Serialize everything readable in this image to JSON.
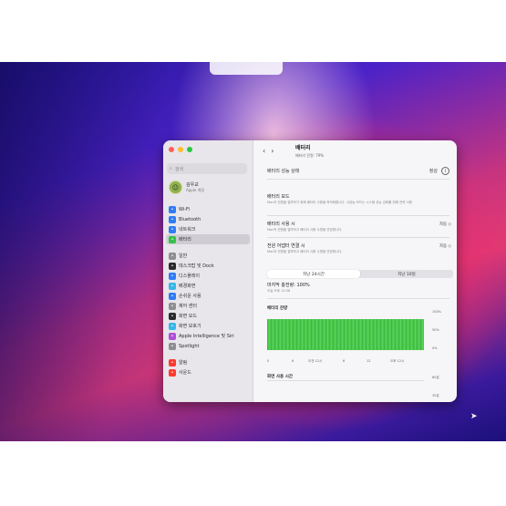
{
  "window": {
    "traffic_colors": [
      "#ff5f57",
      "#febc2e",
      "#28c840"
    ],
    "search_placeholder": "검색",
    "account": {
      "name": "김우교",
      "sub": "Apple 계정"
    },
    "sidebar": {
      "group1": [
        {
          "label": "Wi-Fi",
          "icon": "wifi-icon",
          "color": "#2f7cf6"
        },
        {
          "label": "Bluetooth",
          "icon": "bluetooth-icon",
          "color": "#2f7cf6"
        },
        {
          "label": "네트워크",
          "icon": "network-icon",
          "color": "#2f7cf6"
        },
        {
          "label": "배터리",
          "icon": "battery-icon",
          "color": "#35c04a",
          "selected": true
        }
      ],
      "group2": [
        {
          "label": "일반",
          "icon": "gear-icon",
          "color": "#8e8e93"
        },
        {
          "label": "데스크탑 및 Dock",
          "icon": "dock-icon",
          "color": "#2b2b2e"
        },
        {
          "label": "디스플레이",
          "icon": "display-icon",
          "color": "#2f7cf6"
        },
        {
          "label": "배경화면",
          "icon": "wallpaper-icon",
          "color": "#38b6e8"
        },
        {
          "label": "손쉬운 사용",
          "icon": "accessibility-icon",
          "color": "#2f7cf6"
        },
        {
          "label": "제어 센터",
          "icon": "control-center-icon",
          "color": "#8e8e93"
        },
        {
          "label": "화면 모드",
          "icon": "appearance-icon",
          "color": "#2b2b2e"
        },
        {
          "label": "화면 보호기",
          "icon": "screensaver-icon",
          "color": "#38b6e8"
        },
        {
          "label": "Apple Intelligence 및 Siri",
          "icon": "siri-icon",
          "color": "#b04fd8"
        },
        {
          "label": "Spotlight",
          "icon": "spotlight-icon",
          "color": "#8e8e93"
        }
      ],
      "group3": [
        {
          "label": "알림",
          "icon": "notifications-icon",
          "color": "#ff3b30"
        },
        {
          "label": "사운드",
          "icon": "sound-icon",
          "color": "#ff3b30"
        }
      ]
    },
    "main": {
      "title": "배터리",
      "subtitle": "배터리 잔량: 79%",
      "health_label": "배터리 성능 상태",
      "health_value": "정상",
      "rows": [
        {
          "title": "배터리 모드",
          "desc": "Mac의 전원을 절약하기 위해 배터리 사용을 최적화합니다. 고성능 모드는 시스템 성능 강화를 위해 전력 사용",
          "value": ""
        },
        {
          "title": "배터리 사용 시",
          "desc": "Mac의 전원을 절약하고 배터리 사용 수명을 연장합니다.",
          "value": "자동 ◇"
        },
        {
          "title": "전원 어댑터 연결 시",
          "desc": "Mac의 전원을 절약하고 배터리 사용 수명을 연장합니다.",
          "value": "자동 ◇"
        }
      ],
      "segments": [
        "지난 24시간",
        "지난 10일"
      ],
      "last_charge": "마지막 충전량: 100%",
      "last_charge_time": "오늘 오후 12:58",
      "level_title": "배터리 잔량",
      "y_labels": [
        "100%",
        "50%",
        "0%"
      ],
      "x_labels": [
        "0",
        "6",
        "오전 12시",
        "6",
        "12",
        "오후 12시"
      ],
      "screen_title": "화면 사용 시간",
      "screen_y_labels": [
        "60분",
        "30분"
      ]
    }
  },
  "colors": {
    "battery_fill": "#4cc84d",
    "accent": "#2f7cf6"
  }
}
